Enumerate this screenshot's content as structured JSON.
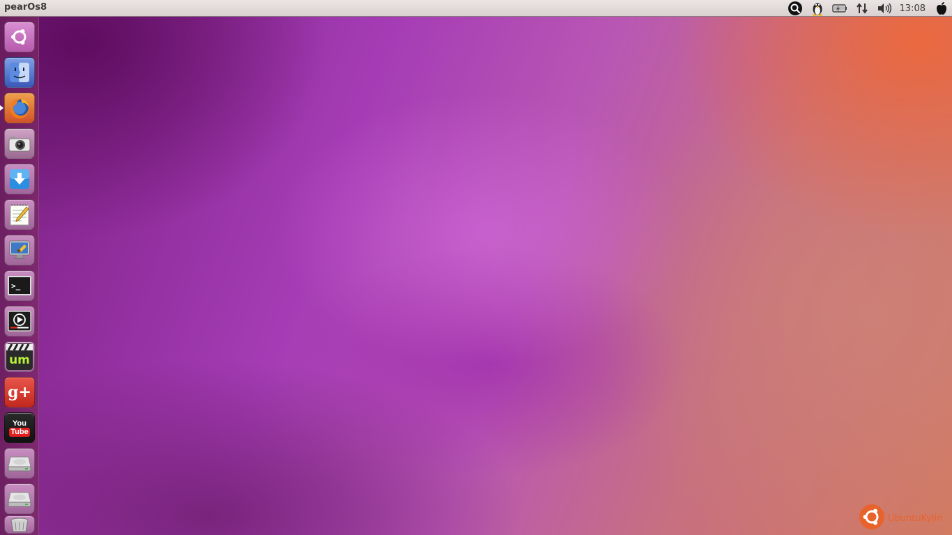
{
  "panel": {
    "title": "pearOs8",
    "clock": "13:08",
    "indicators": [
      "search-icon",
      "penguin-icon",
      "battery-icon",
      "network-icon",
      "volume-icon",
      "apple-icon"
    ]
  },
  "launcher": {
    "items": [
      {
        "name": "dash-home",
        "icon": "ubuntu-logo-icon"
      },
      {
        "name": "finder",
        "icon": "finder-face-icon"
      },
      {
        "name": "firefox",
        "icon": "firefox-icon",
        "running": true
      },
      {
        "name": "camera",
        "icon": "camera-icon"
      },
      {
        "name": "downloader",
        "icon": "download-arrow-icon"
      },
      {
        "name": "text-editor",
        "icon": "notepad-pencil-icon"
      },
      {
        "name": "system-settings",
        "icon": "monitor-brush-icon"
      },
      {
        "name": "terminal",
        "icon": "terminal-icon",
        "label": ">_"
      },
      {
        "name": "media-player",
        "icon": "video-play-icon"
      },
      {
        "name": "umplayer",
        "icon": "clapperboard-um-icon",
        "label": "um"
      },
      {
        "name": "google-plus",
        "icon": "google-plus-icon",
        "label": "g+"
      },
      {
        "name": "youtube",
        "icon": "youtube-icon",
        "label_top": "You",
        "label_bottom": "Tube"
      },
      {
        "name": "drive-1",
        "icon": "hard-drive-icon"
      },
      {
        "name": "drive-2",
        "icon": "hard-drive-icon"
      },
      {
        "name": "trash",
        "icon": "trash-icon"
      }
    ]
  },
  "watermark": {
    "text": "UbuntuKylin",
    "color": "#e8632c"
  },
  "colors": {
    "panel": "#e0d9d7",
    "launcher": "#6e2460",
    "accent": "#e8632c"
  }
}
